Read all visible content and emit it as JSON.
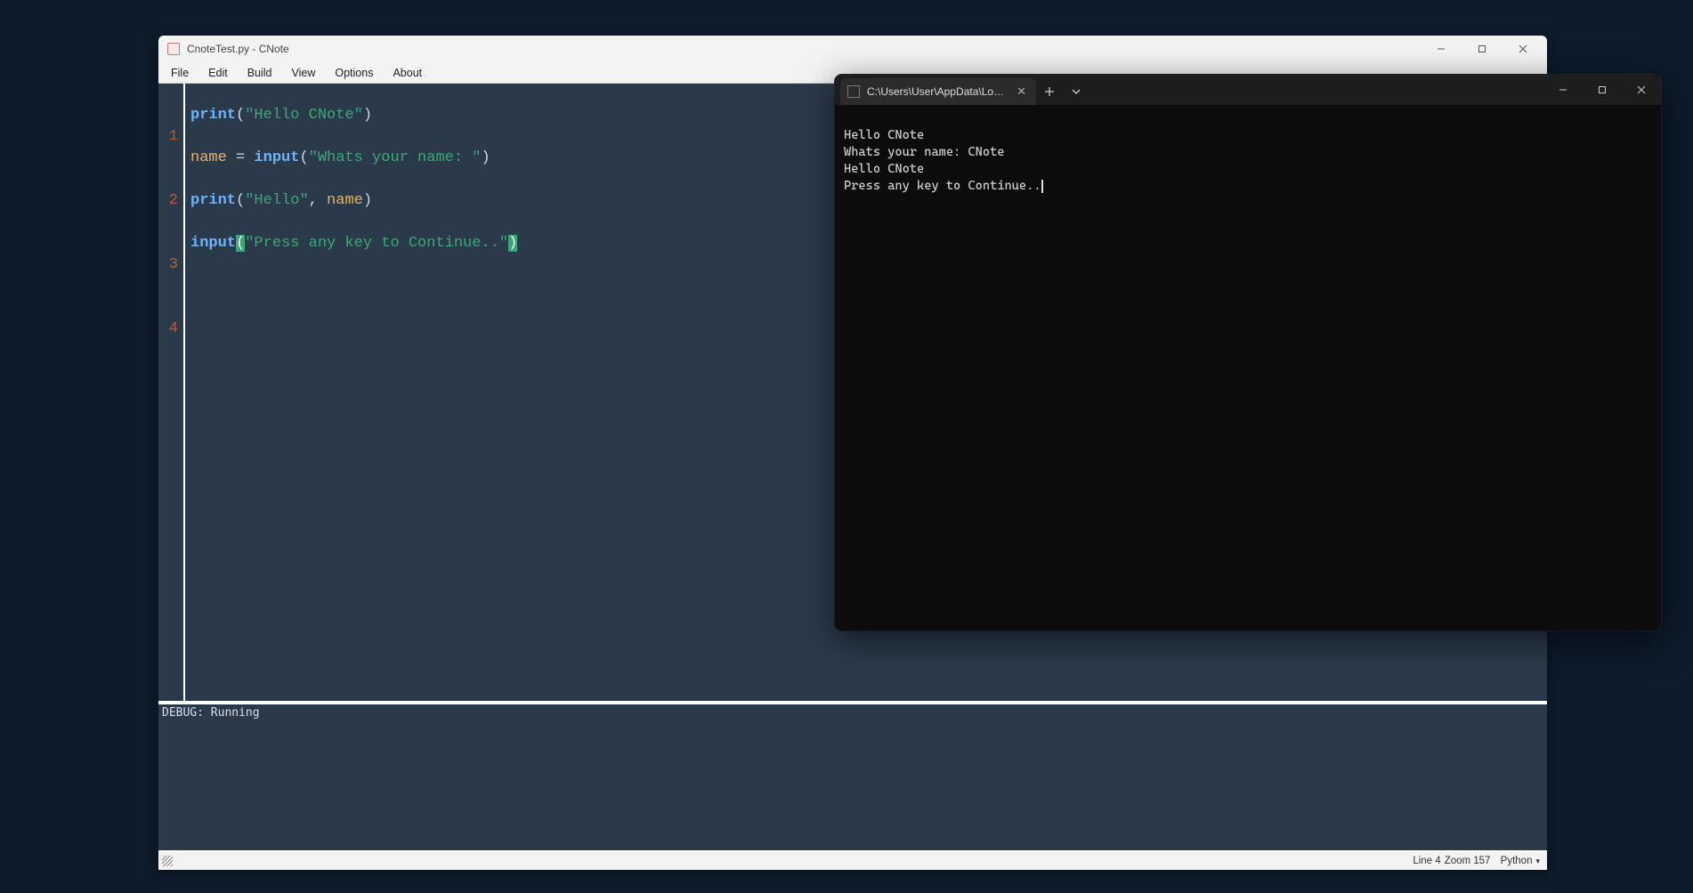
{
  "editor": {
    "title": "CnoteTest.py - CNote",
    "menu": [
      "File",
      "Edit",
      "Build",
      "View",
      "Options",
      "About"
    ],
    "gutter": [
      "1",
      "2",
      "3",
      "4"
    ],
    "code": {
      "l1": {
        "fn": "print",
        "p1": "(",
        "q1": "\"",
        "s": "Hello CNote",
        "q2": "\"",
        "p2": ")"
      },
      "l2": {
        "var": "name",
        "eq": " = ",
        "fn": "input",
        "p1": "(",
        "q1": "\"",
        "s": "Whats your name: ",
        "q2": "\"",
        "p2": ")"
      },
      "l3": {
        "fn": "print",
        "p1": "(",
        "q1": "\"",
        "s": "Hello",
        "q2": "\"",
        "c": ", ",
        "var": "name",
        "p2": ")"
      },
      "l4": {
        "fn": "input",
        "p1": "(",
        "q1": "\"",
        "s": "Press any key to Continue..",
        "q2": "\"",
        "p2": ")"
      }
    },
    "debug": "DEBUG: Running",
    "status": {
      "line": "Line 4",
      "zoom": "Zoom 157",
      "lang": "Python"
    }
  },
  "terminal": {
    "tab_title": "C:\\Users\\User\\AppData\\Local\\P\\",
    "lines": [
      "Hello CNote",
      "Whats your name: CNote",
      "Hello CNote",
      "Press any key to Continue.."
    ]
  }
}
